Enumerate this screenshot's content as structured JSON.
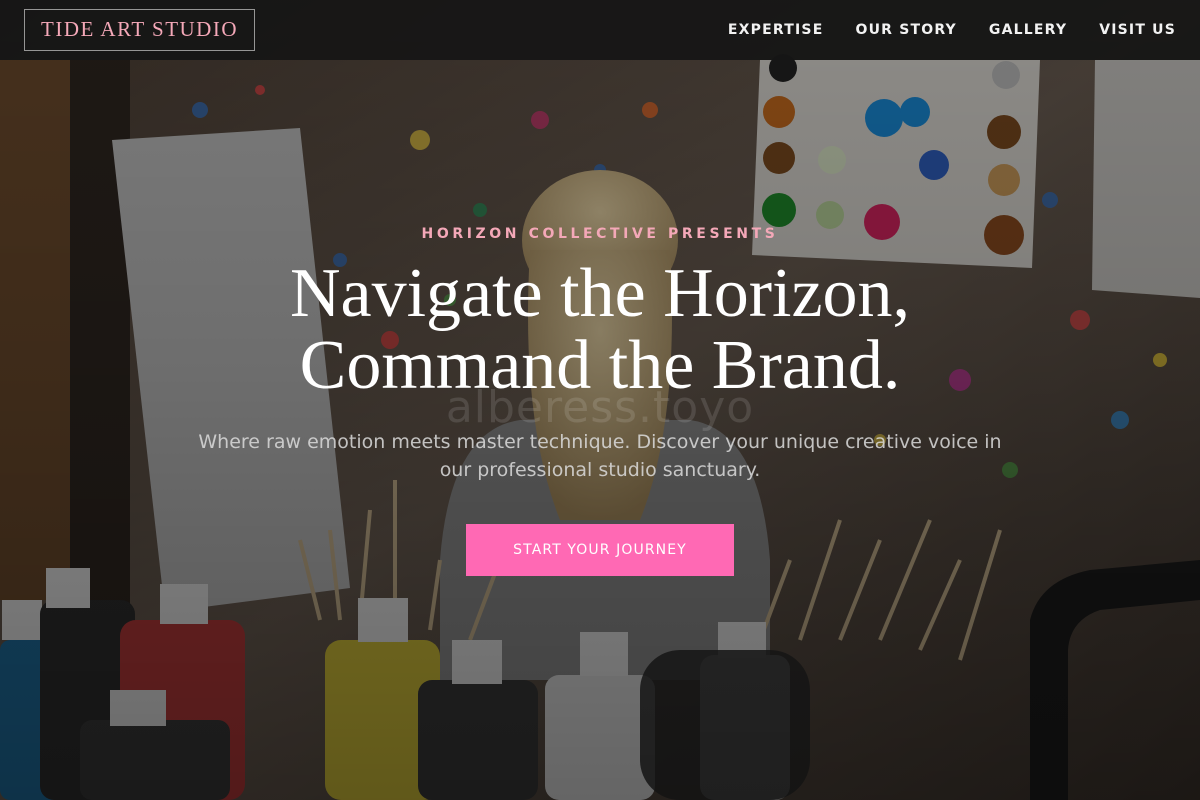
{
  "header": {
    "logo": "TIDE ART STUDIO",
    "nav": [
      {
        "label": "EXPERTISE"
      },
      {
        "label": "OUR STORY"
      },
      {
        "label": "GALLERY"
      },
      {
        "label": "VISIT US"
      }
    ]
  },
  "hero": {
    "eyebrow": "HORIZON COLLECTIVE PRESENTS",
    "headline_line1": "Navigate the Horizon,",
    "headline_line2": "Command the Brand.",
    "subtext": "Where raw emotion meets master technique. Discover your unique creative voice in our professional studio sanctuary.",
    "watermark": "alberess.toyo",
    "cta": "START YOUR JOURNEY"
  },
  "colors": {
    "accent_pink": "#ff69b4",
    "logo_pink": "#f4a8b8",
    "header_bg": "#161616"
  }
}
